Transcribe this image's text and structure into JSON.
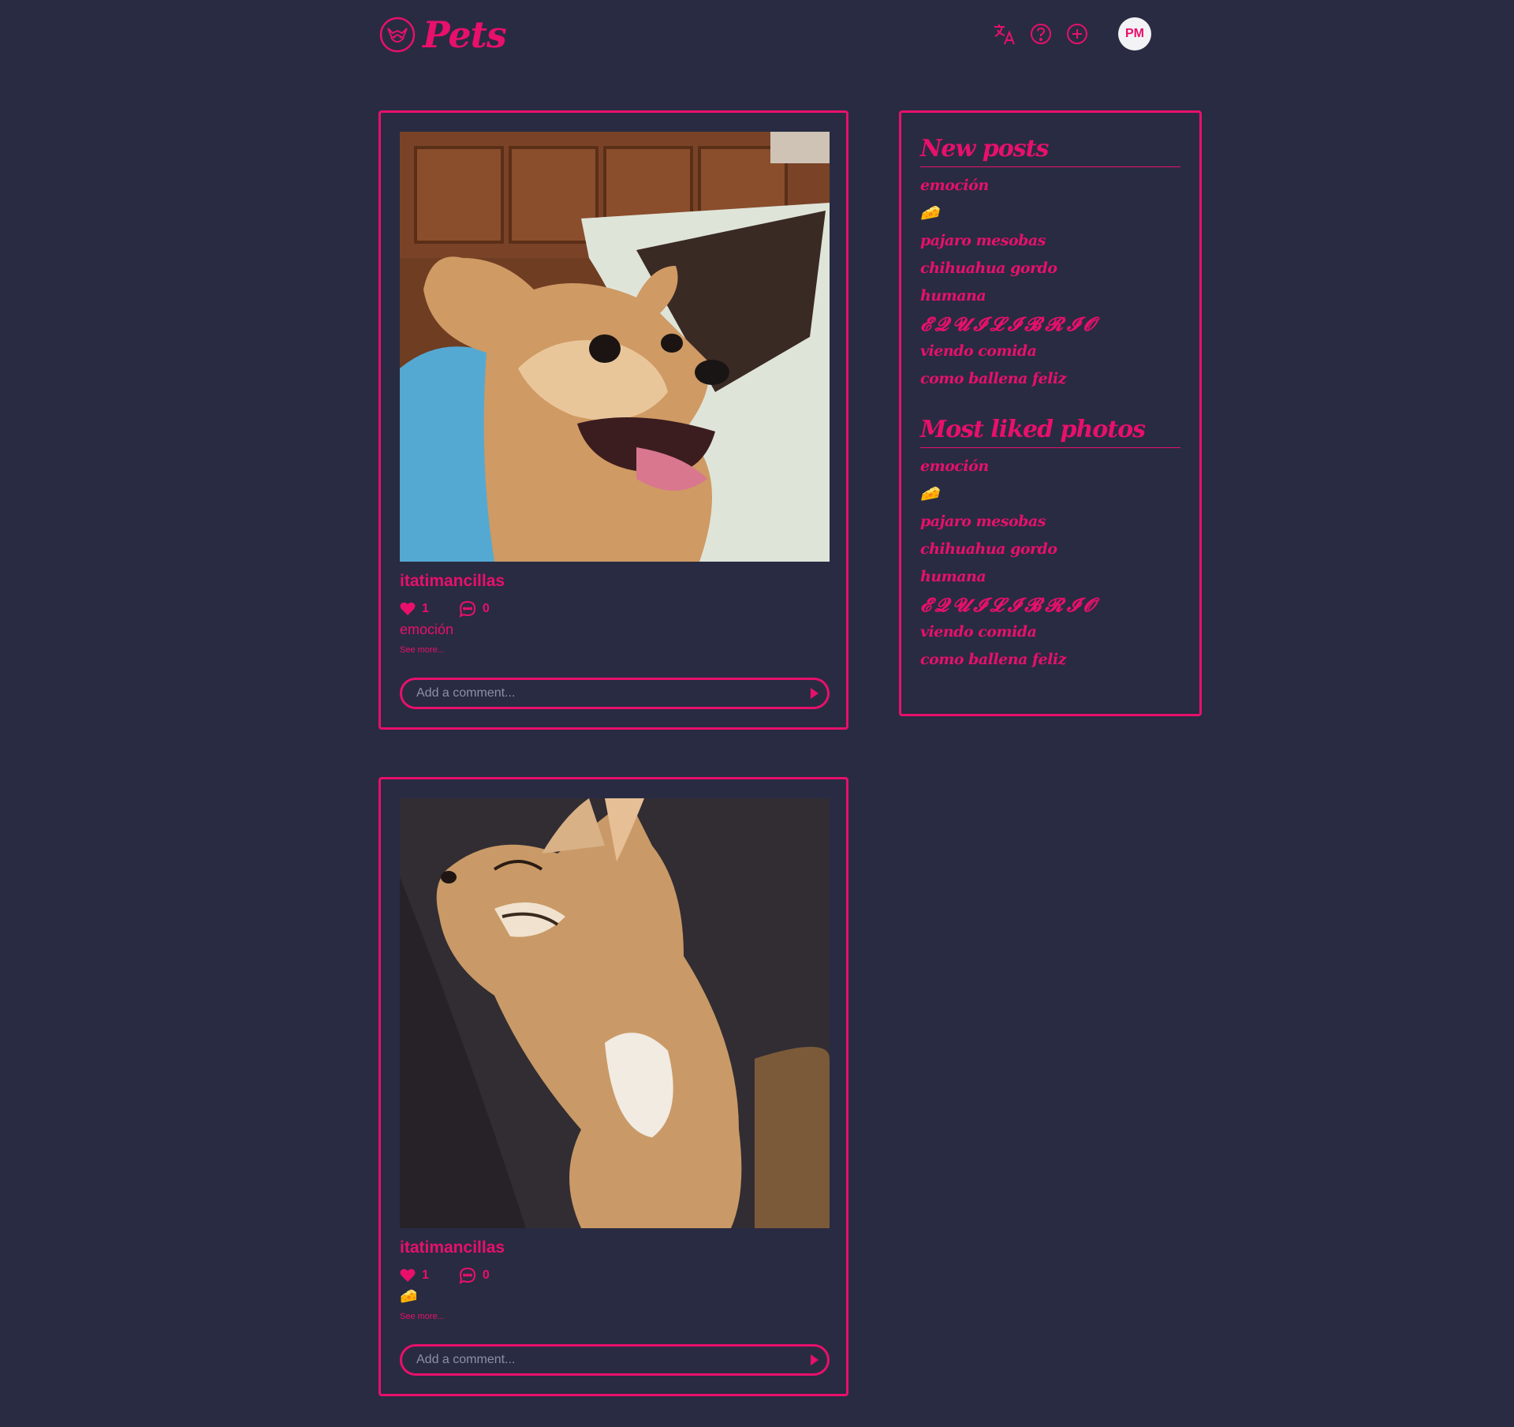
{
  "header": {
    "logo_text": "Pets",
    "avatar_initials": "PM",
    "icons": [
      "pets-logo-icon",
      "translate-icon",
      "help-icon",
      "add-post-icon"
    ]
  },
  "posts": [
    {
      "username": "itatimancillas",
      "likes": "1",
      "comments": "0",
      "caption": "emoción",
      "see_more": "See more...",
      "comment_placeholder": "Add a comment...",
      "photo": "chihuahua-smiling-photo"
    },
    {
      "username": "itatimancillas",
      "likes": "1",
      "comments": "0",
      "caption": "🧀",
      "see_more": "See more...",
      "comment_placeholder": "Add a comment...",
      "photo": "chihuahua-sleeping-photo"
    }
  ],
  "sidebar": {
    "new_posts": {
      "title": "New posts",
      "items": [
        "emoción",
        "🧀",
        "pajaro mesobas",
        "chihuahua gordo",
        "humana",
        "𝓔𝓠𝓤𝓘𝓛𝓘𝓑𝓡𝓘𝓞",
        "viendo comida",
        "como ballena feliz"
      ]
    },
    "most_liked": {
      "title": "Most liked photos",
      "items": [
        "emoción",
        "🧀",
        "pajaro mesobas",
        "chihuahua gordo",
        "humana",
        "𝓔𝓠𝓤𝓘𝓛𝓘𝓑𝓡𝓘𝓞",
        "viendo comida",
        "como ballena feliz"
      ]
    }
  },
  "colors": {
    "background": "#292b42",
    "accent": "#e8106b",
    "avatar_bg": "#f3f3f6"
  }
}
